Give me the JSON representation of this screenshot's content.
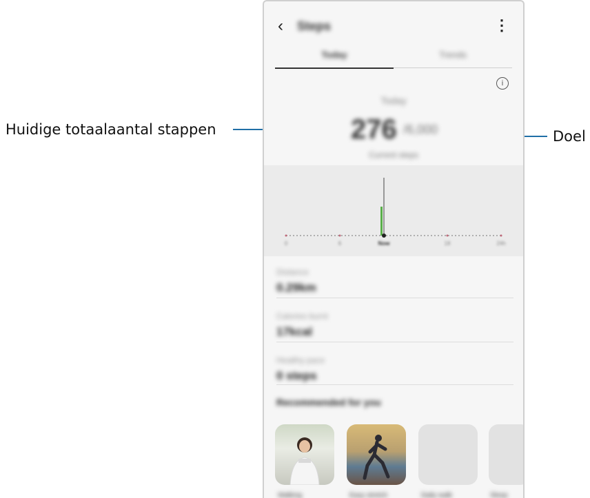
{
  "callouts": {
    "left": "Huidige totaalaantal stappen",
    "right": "Doel"
  },
  "app": {
    "title": "Steps",
    "tabs": [
      "Today",
      "Trends"
    ],
    "date": "Today",
    "steps_count": "276",
    "steps_goal": "/6,000",
    "steps_unit": "Current steps",
    "chart": {
      "tick_labels": [
        "0",
        "6",
        "Now",
        "18",
        "24h"
      ]
    },
    "stats": [
      {
        "label": "Distance",
        "value": "0.29km"
      },
      {
        "label": "Calories burnt",
        "value": "17kcal"
      },
      {
        "label": "Healthy pace",
        "value": "0 steps"
      }
    ],
    "recommended_heading": "Recommended for you",
    "card_captions": [
      "Walking",
      "Easy stretch",
      "Daily walk",
      "Sleep"
    ]
  }
}
